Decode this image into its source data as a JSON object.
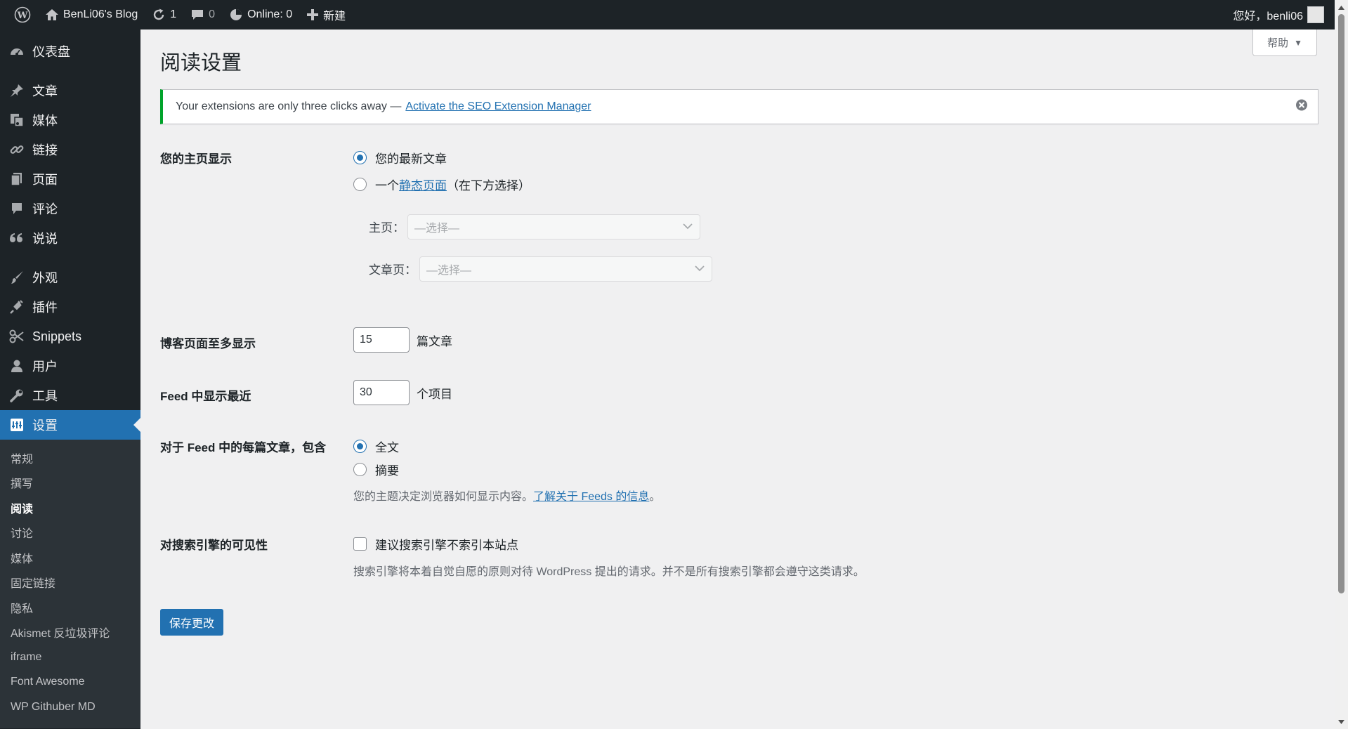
{
  "colors": {
    "adminbar_bg": "#1d2327",
    "sidebar_bg": "#1d2327",
    "submenu_bg": "#2c3338",
    "accent": "#2271b1",
    "notice_border": "#00a32a",
    "page_bg": "#f0f0f1"
  },
  "adminbar": {
    "site_name": "BenLi06's Blog",
    "updates_count": "1",
    "comments_count": "0",
    "online_label": "Online: 0",
    "new_label": "新建",
    "greeting": "您好，benli06"
  },
  "sidebar": {
    "items": [
      {
        "label": "仪表盘",
        "icon": "dashboard-icon"
      },
      {
        "label": "文章",
        "icon": "pin-icon"
      },
      {
        "label": "媒体",
        "icon": "media-icon"
      },
      {
        "label": "链接",
        "icon": "link-icon"
      },
      {
        "label": "页面",
        "icon": "page-icon"
      },
      {
        "label": "评论",
        "icon": "comment-icon"
      },
      {
        "label": "说说",
        "icon": "quote-icon"
      },
      {
        "label": "外观",
        "icon": "brush-icon"
      },
      {
        "label": "插件",
        "icon": "plugin-icon"
      },
      {
        "label": "Snippets",
        "icon": "scissors-icon"
      },
      {
        "label": "用户",
        "icon": "user-icon"
      },
      {
        "label": "工具",
        "icon": "wrench-icon"
      },
      {
        "label": "设置",
        "icon": "settings-icon"
      }
    ],
    "submenu": [
      "常规",
      "撰写",
      "阅读",
      "讨论",
      "媒体",
      "固定链接",
      "隐私",
      "Akismet 反垃圾评论",
      "iframe",
      "Font Awesome",
      "WP Githuber MD"
    ]
  },
  "help_tab": {
    "label": "帮助"
  },
  "page": {
    "title": "阅读设置"
  },
  "notice": {
    "text": "Your extensions are only three clicks away —",
    "link": "Activate the SEO Extension Manager"
  },
  "homepage_display": {
    "label": "您的主页显示",
    "option_latest": "您的最新文章",
    "option_static_prefix": "一个",
    "option_static_link": "静态页面",
    "option_static_suffix": "（在下方选择）",
    "homepage_label": "主页：",
    "homepage_value": "—选择—",
    "postspage_label": "文章页：",
    "postspage_value": "—选择—"
  },
  "posts_per_page": {
    "label": "博客页面至多显示",
    "value": "15",
    "suffix": "篇文章"
  },
  "feed_items": {
    "label": "Feed 中显示最近",
    "value": "30",
    "suffix": "个项目"
  },
  "feed_content": {
    "label": "对于 Feed 中的每篇文章，包含",
    "option_full": "全文",
    "option_summary": "摘要",
    "desc_prefix": "您的主题决定浏览器如何显示内容。",
    "desc_link": "了解关于 Feeds 的信息",
    "desc_suffix": "。"
  },
  "search_visibility": {
    "label": "对搜索引擎的可见性",
    "checkbox_label": "建议搜索引擎不索引本站点",
    "desc": "搜索引擎将本着自觉自愿的原则对待 WordPress 提出的请求。并不是所有搜索引擎都会遵守这类请求。"
  },
  "save_button": {
    "label": "保存更改"
  }
}
